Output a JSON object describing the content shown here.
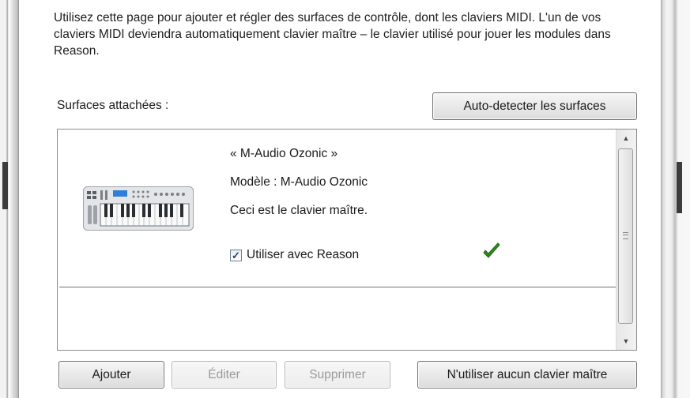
{
  "intro_text": "Utilisez cette page pour ajouter et régler des surfaces de contrôle, dont les claviers MIDI. L'un de vos claviers MIDI deviendra automatiquement clavier maître – le clavier utilisé pour jouer les modules dans Reason.",
  "surfaces_label": "Surfaces attachées :",
  "auto_detect_label": "Auto-detecter les surfaces",
  "surfaces": [
    {
      "name": "« M-Audio Ozonic »",
      "model": "Modèle : M-Audio Ozonic",
      "status": "Ceci est le clavier maître.",
      "use_label": "Utiliser avec Reason",
      "use_checked": true,
      "icon": "midi-keyboard-icon",
      "status_icon": "green-check-icon",
      "status_color": "#2e8b1e"
    }
  ],
  "buttons": {
    "add": "Ajouter",
    "edit": "Éditer",
    "delete": "Supprimer",
    "no_master": "N'utiliser aucun clavier maître"
  }
}
